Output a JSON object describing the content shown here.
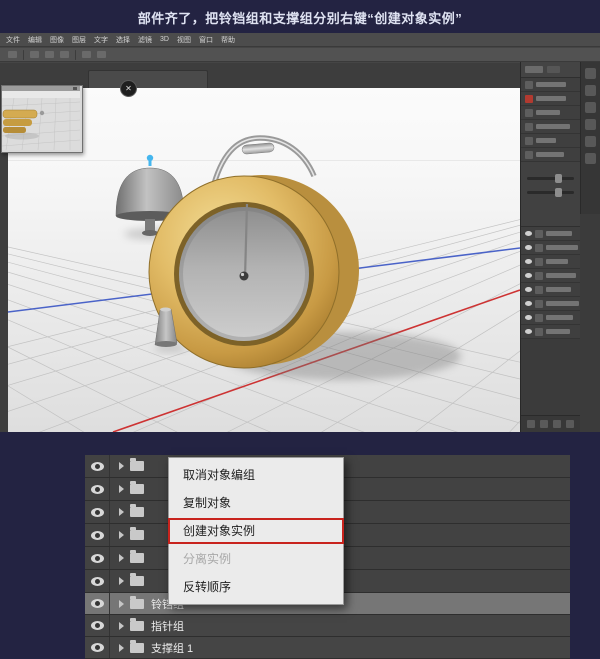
{
  "title": "部件齐了，把铃铛组和支撑组分别右键“创建对象实例”",
  "photoshop": {
    "menu_bar": {
      "items": [
        "文件",
        "编辑",
        "图像",
        "图层",
        "文字",
        "选择",
        "滤镜",
        "3D",
        "视图",
        "窗口",
        "帮助"
      ]
    }
  },
  "icons": {
    "close_glyph": "✕"
  },
  "context_menu": {
    "items": [
      {
        "label": "取消对象编组",
        "enabled": true,
        "highlighted": false
      },
      {
        "label": "复制对象",
        "enabled": true,
        "highlighted": false
      },
      {
        "label": "创建对象实例",
        "enabled": true,
        "highlighted": true
      },
      {
        "label": "分离实例",
        "enabled": false,
        "highlighted": false
      },
      {
        "label": "反转顺序",
        "enabled": true,
        "highlighted": false
      }
    ]
  },
  "layers_panel": {
    "rows": [
      {
        "label": "铃铛组",
        "selected": true
      },
      {
        "label": "指针组",
        "selected": false
      },
      {
        "label": "支撑组 1",
        "selected": false
      }
    ]
  },
  "colors": {
    "page_background": "#232342",
    "highlight_box": "#c8231d",
    "gold": "#d7ae56",
    "axis_red": "#cd3333",
    "axis_blue": "#4a63c8"
  }
}
